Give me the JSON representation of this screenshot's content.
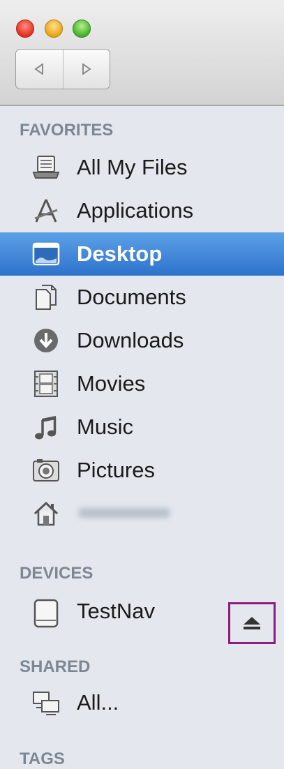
{
  "window": {
    "controls": [
      "close",
      "minimize",
      "zoom"
    ],
    "nav": {
      "back_icon": "chevron-left-icon",
      "forward_icon": "chevron-right-icon"
    }
  },
  "sidebar": {
    "favorites": {
      "title": "FAVORITES",
      "items": [
        {
          "label": "All My Files",
          "icon": "all-files-icon"
        },
        {
          "label": "Applications",
          "icon": "applications-icon"
        },
        {
          "label": "Desktop",
          "icon": "desktop-icon",
          "selected": true
        },
        {
          "label": "Documents",
          "icon": "documents-icon"
        },
        {
          "label": "Downloads",
          "icon": "downloads-icon"
        },
        {
          "label": "Movies",
          "icon": "movies-icon"
        },
        {
          "label": "Music",
          "icon": "music-icon"
        },
        {
          "label": "Pictures",
          "icon": "pictures-icon"
        },
        {
          "label": "",
          "icon": "home-icon",
          "note": "name obscured"
        }
      ]
    },
    "devices": {
      "title": "DEVICES",
      "items": [
        {
          "label": "TestNav",
          "icon": "drive-icon",
          "eject_icon": "eject-icon"
        }
      ]
    },
    "shared": {
      "title": "SHARED",
      "items": [
        {
          "label": "All...",
          "icon": "network-icon"
        }
      ]
    },
    "tags": {
      "title": "TAGS"
    }
  },
  "colors": {
    "selection": "#2f7ad3",
    "highlight_box": "#8d1c7d",
    "sidebar_bg": "#e4e8ee"
  }
}
